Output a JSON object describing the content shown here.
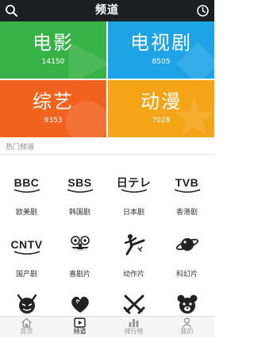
{
  "header": {
    "title": "频道"
  },
  "tiles": [
    {
      "name": "电影",
      "count": "14150",
      "color": "#37b246"
    },
    {
      "name": "电视剧",
      "count": "8505",
      "color": "#1ea3e6"
    },
    {
      "name": "综艺",
      "count": "9353",
      "color": "#f2621f"
    },
    {
      "name": "动漫",
      "count": "7028",
      "color": "#f4a417"
    }
  ],
  "hot": {
    "title": "热门频道",
    "items": [
      {
        "logo": "BBC",
        "label": "欧美剧"
      },
      {
        "logo": "SBS",
        "label": "韩国剧"
      },
      {
        "logo": "日テレ",
        "label": "日本剧"
      },
      {
        "logo": "TVB",
        "label": "香港剧"
      },
      {
        "logo": "CNTV",
        "label": "国产剧",
        "icon": "cntv-logo"
      },
      {
        "label": "喜剧片",
        "icon": "clown-face-icon"
      },
      {
        "label": "动作片",
        "icon": "kick-fighter-icon"
      },
      {
        "label": "科幻片",
        "icon": "planet-icon"
      }
    ],
    "row3_icons": [
      "devil-face-icon",
      "hearts-icon",
      "crossed-swords-icon",
      "bear-face-icon"
    ]
  },
  "tabbar": {
    "tabs": [
      {
        "label": "首页",
        "icon": "home-icon"
      },
      {
        "label": "频道",
        "icon": "play-icon",
        "active": true
      },
      {
        "label": "排行榜",
        "icon": "ranking-icon"
      },
      {
        "label": "我的",
        "icon": "user-icon"
      }
    ]
  }
}
